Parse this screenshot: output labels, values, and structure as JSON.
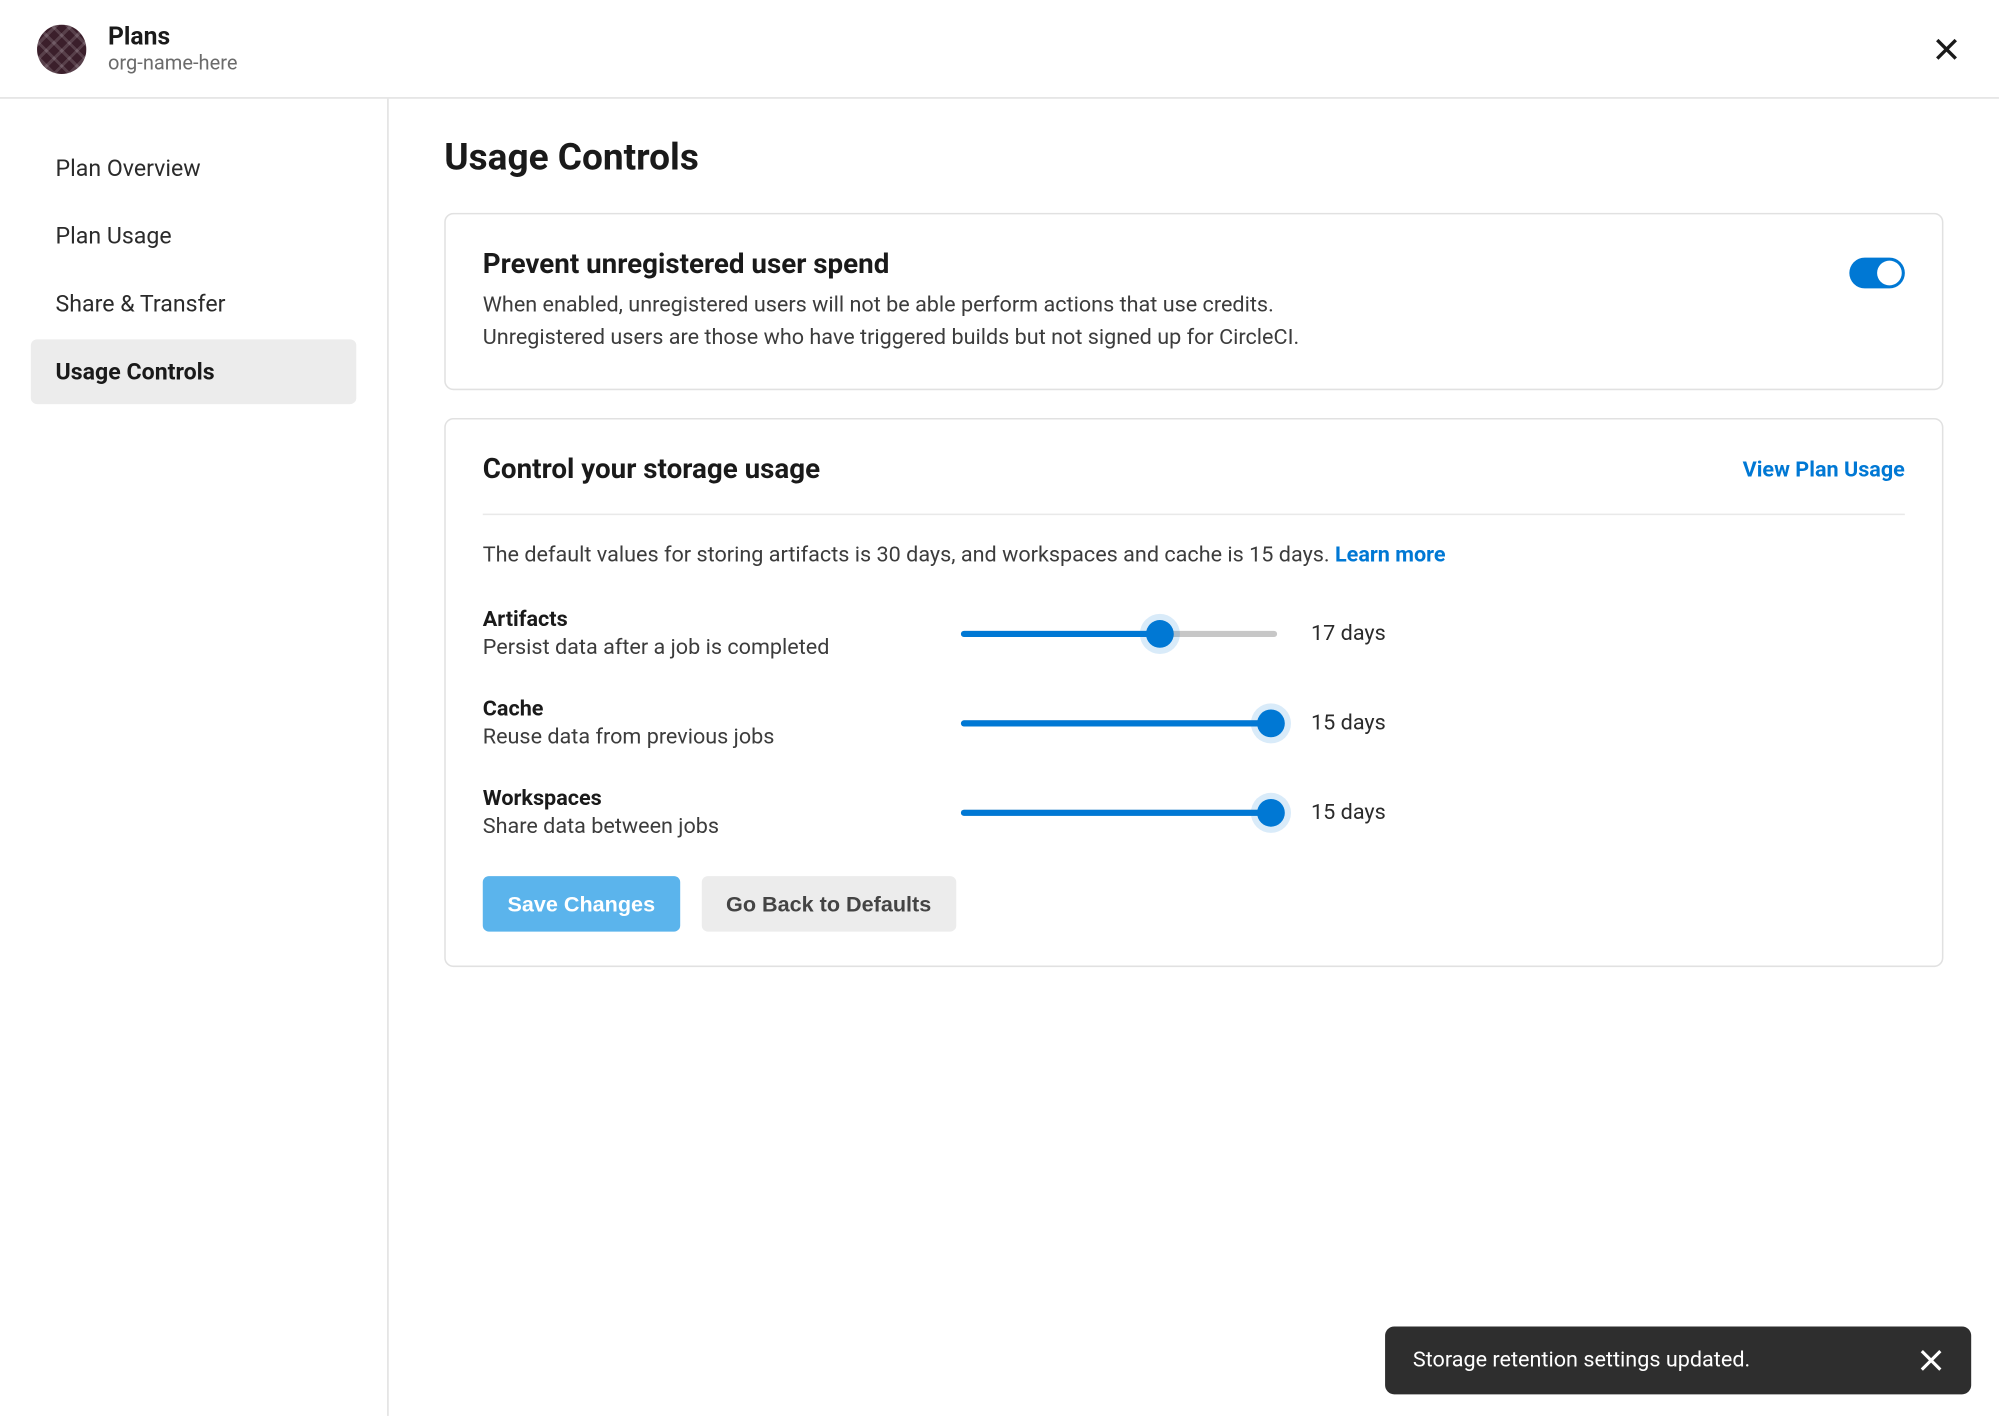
{
  "header": {
    "title": "Plans",
    "org": "org-name-here"
  },
  "sidebar": {
    "items": [
      {
        "label": "Plan Overview",
        "active": false
      },
      {
        "label": "Plan Usage",
        "active": false
      },
      {
        "label": "Share & Transfer",
        "active": false
      },
      {
        "label": "Usage Controls",
        "active": true
      }
    ]
  },
  "main": {
    "title": "Usage Controls",
    "prevent_spend": {
      "title": "Prevent unregistered user spend",
      "desc_line1": "When enabled, unregistered users will not be able perform actions that use credits.",
      "desc_line2": "Unregistered users are those who have triggered builds but not signed up for CircleCI.",
      "enabled": true
    },
    "storage": {
      "title": "Control your storage usage",
      "view_link": "View Plan Usage",
      "desc_prefix": "The default values for storing artifacts is 30 days, and workspaces and cache is 15 days. ",
      "learn_more": "Learn more",
      "sliders": [
        {
          "name": "Artifacts",
          "desc": "Persist data after a job is completed",
          "value": 17,
          "max": 30,
          "display": "17 days"
        },
        {
          "name": "Cache",
          "desc": "Reuse data from previous jobs",
          "value": 15,
          "max": 15,
          "display": "15 days"
        },
        {
          "name": "Workspaces",
          "desc": "Share data between jobs",
          "value": 15,
          "max": 15,
          "display": "15 days"
        }
      ],
      "save_label": "Save Changes",
      "defaults_label": "Go Back to Defaults"
    }
  },
  "toast": {
    "message": "Storage retention settings updated."
  }
}
